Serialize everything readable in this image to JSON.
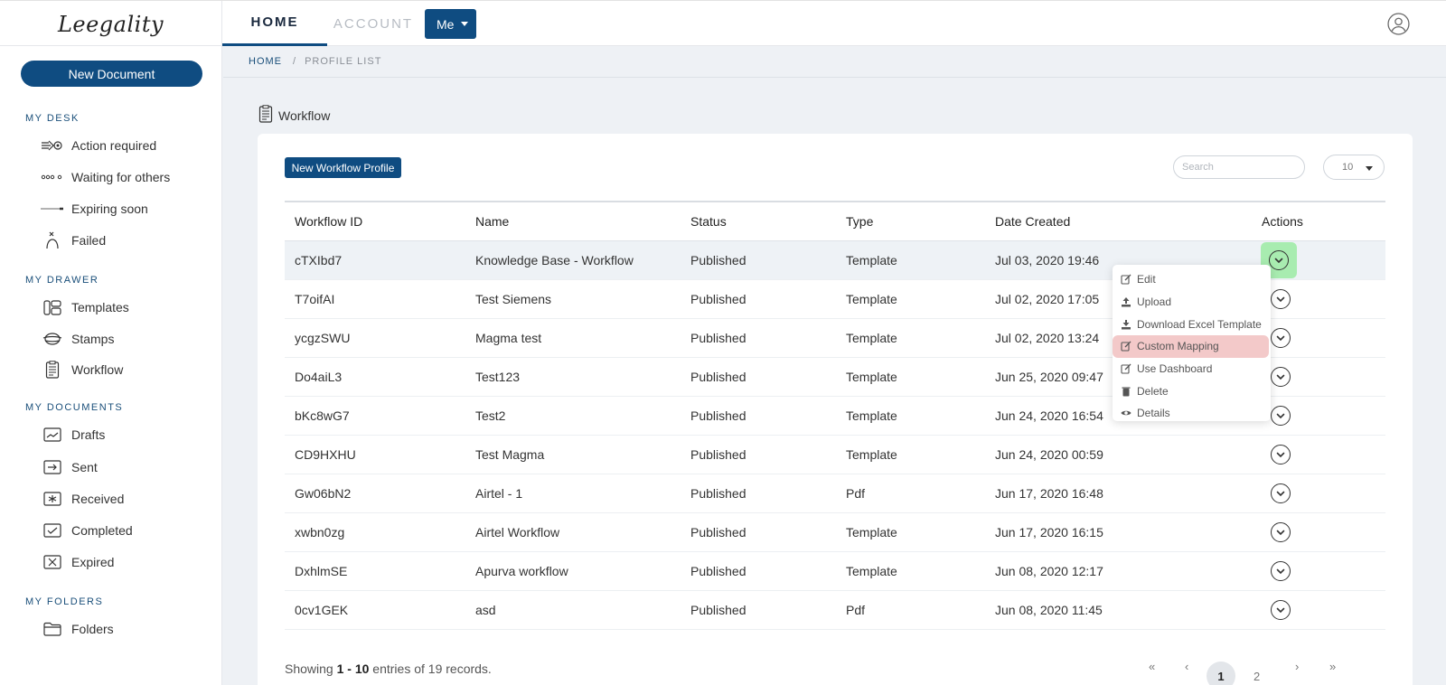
{
  "brand": {
    "logo_text": "Leegality"
  },
  "topnav": {
    "tabs": [
      {
        "label": "HOME",
        "active": true
      },
      {
        "label": "ACCOUNT",
        "active": false
      }
    ],
    "me_label": "Me",
    "profile_icon": "user-circle-icon"
  },
  "sidebar": {
    "new_document_label": "New Document",
    "sections": [
      {
        "title": "MY DESK",
        "items": [
          {
            "label": "Action required",
            "icon": "action-required-icon"
          },
          {
            "label": "Waiting for others",
            "icon": "waiting-dots-icon"
          },
          {
            "label": "Expiring soon",
            "icon": "expiring-line-icon"
          },
          {
            "label": "Failed",
            "icon": "failed-person-icon"
          }
        ]
      },
      {
        "title": "MY DRAWER",
        "items": [
          {
            "label": "Templates",
            "icon": "templates-icon"
          },
          {
            "label": "Stamps",
            "icon": "stamps-icon"
          },
          {
            "label": "Workflow",
            "icon": "workflow-doc-icon"
          }
        ]
      },
      {
        "title": "MY DOCUMENTS",
        "items": [
          {
            "label": "Drafts",
            "icon": "drafts-icon"
          },
          {
            "label": "Sent",
            "icon": "sent-icon"
          },
          {
            "label": "Received",
            "icon": "received-icon"
          },
          {
            "label": "Completed",
            "icon": "completed-icon"
          },
          {
            "label": "Expired",
            "icon": "expired-icon"
          }
        ]
      },
      {
        "title": "MY FOLDERS",
        "items": [
          {
            "label": "Folders",
            "icon": "folder-icon"
          }
        ]
      }
    ]
  },
  "breadcrumb": {
    "home": "HOME",
    "separator": "/",
    "current": "PROFILE LIST"
  },
  "page": {
    "title": "Workflow"
  },
  "toolbar": {
    "new_workflow_label": "New Workflow Profile",
    "search_placeholder": "Search",
    "page_size": "10"
  },
  "table": {
    "headers": [
      "Workflow ID",
      "Name",
      "Status",
      "Type",
      "Date Created",
      "Actions"
    ],
    "rows": [
      [
        "cTXIbd7",
        "Knowledge Base - Workflow",
        "Published",
        "Template",
        "Jul 03, 2020 19:46"
      ],
      [
        "T7oifAI",
        "Test Siemens",
        "Published",
        "Template",
        "Jul 02, 2020 17:05"
      ],
      [
        "ycgzSWU",
        "Magma test",
        "Published",
        "Template",
        "Jul 02, 2020 13:24"
      ],
      [
        "Do4aiL3",
        "Test123",
        "Published",
        "Template",
        "Jun 25, 2020 09:47"
      ],
      [
        "bKc8wG7",
        "Test2",
        "Published",
        "Template",
        "Jun 24, 2020 16:54"
      ],
      [
        "CD9HXHU",
        "Test Magma",
        "Published",
        "Template",
        "Jun 24, 2020 00:59"
      ],
      [
        "Gw06bN2",
        "Airtel - 1",
        "Published",
        "Pdf",
        "Jun 17, 2020 16:48"
      ],
      [
        "xwbn0zg",
        "Airtel Workflow",
        "Published",
        "Template",
        "Jun 17, 2020 16:15"
      ],
      [
        "DxhlmSE",
        "Apurva workflow",
        "Published",
        "Template",
        "Jun 08, 2020 12:17"
      ],
      [
        "0cv1GEK",
        "asd",
        "Published",
        "Pdf",
        "Jun 08, 2020 11:45"
      ]
    ]
  },
  "action_menu": {
    "items": [
      {
        "label": "Edit",
        "icon": "edit-icon"
      },
      {
        "label": "Upload",
        "icon": "upload-icon"
      },
      {
        "label": "Download Excel Template",
        "icon": "download-icon"
      },
      {
        "label": "Custom Mapping",
        "icon": "edit-icon",
        "highlighted": true
      },
      {
        "label": "Use Dashboard",
        "icon": "edit-icon"
      },
      {
        "label": "Delete",
        "icon": "trash-icon"
      },
      {
        "label": "Details",
        "icon": "eye-icon"
      }
    ]
  },
  "footer": {
    "prefix": "Showing",
    "range": "1 - 10",
    "middle": "entries of",
    "total": "19",
    "suffix": "records."
  },
  "pagination": {
    "first": "«",
    "prev": "‹",
    "pages": [
      "1",
      "2"
    ],
    "current": "1",
    "next": "›",
    "last": "»"
  }
}
